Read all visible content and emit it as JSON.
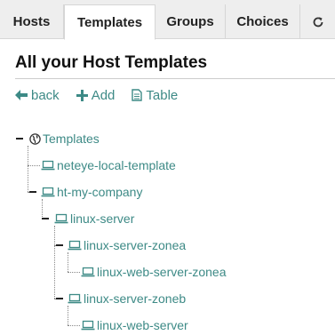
{
  "tabs": [
    {
      "label": "Hosts"
    },
    {
      "label": "Templates"
    },
    {
      "label": "Groups"
    },
    {
      "label": "Choices"
    }
  ],
  "header": {
    "title": "All your Host Templates"
  },
  "actions": {
    "back": "back",
    "add": "Add",
    "table": "Table"
  },
  "tree": {
    "root": "Templates",
    "nodes": [
      "neteye-local-template",
      "ht-my-company",
      "linux-server",
      "linux-server-zonea",
      "linux-web-server-zonea",
      "linux-server-zoneb",
      "linux-web-server"
    ]
  },
  "colors": {
    "accent": "#3d8a86",
    "tabbar_bg": "#eeeeee"
  },
  "icons": {
    "refresh": "refresh-icon",
    "back": "arrow-left-icon",
    "add": "plus-icon",
    "table": "document-icon",
    "root": "globe-icon",
    "host": "laptop-icon"
  }
}
